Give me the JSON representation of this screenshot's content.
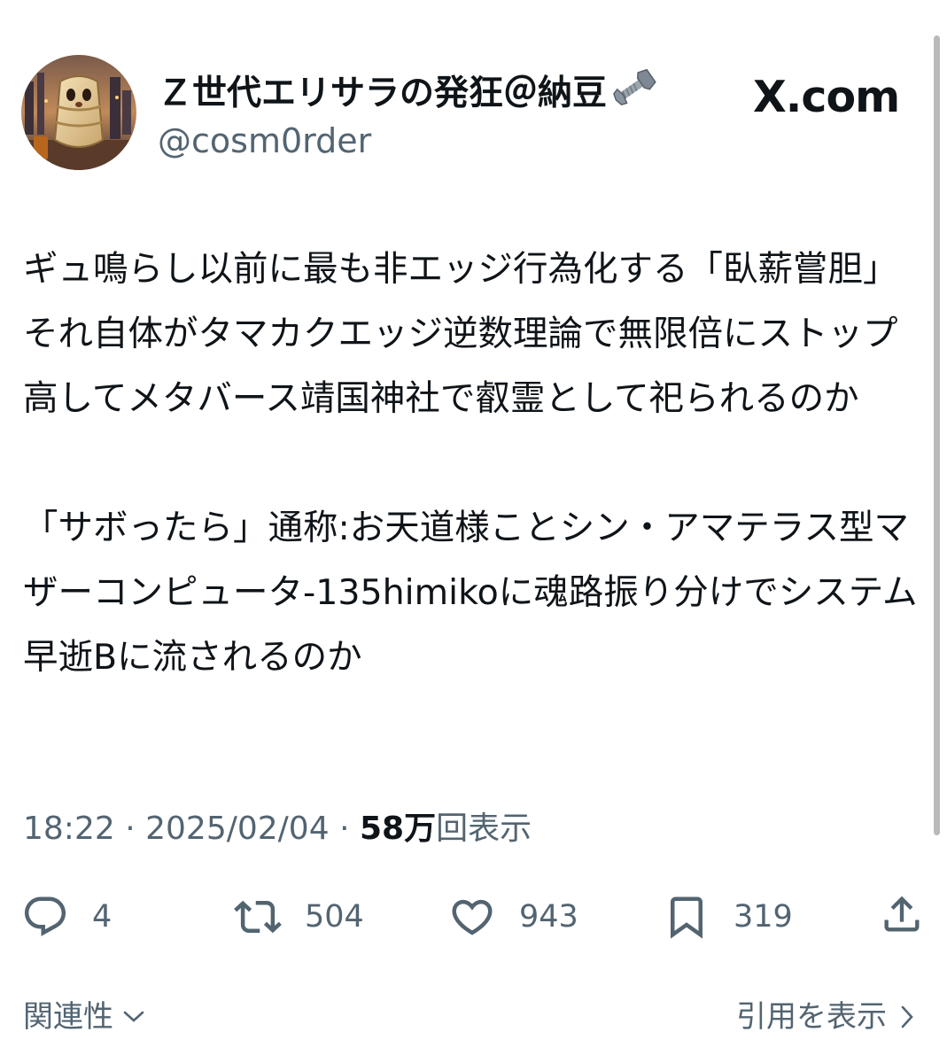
{
  "author": {
    "display_name": "Ｚ世代エリサラの発狂＠納豆",
    "handle": "@cosm0rder",
    "name_emoji_icon": "nut-and-bolt-icon"
  },
  "source": "X.com",
  "tweet": {
    "text": "ギュ鳴らし以前に最も非エッジ行為化する「臥薪嘗胆」それ自体がタマカクエッジ逆数理論で無限倍にストップ高してメタバース靖国神社で叡霊として祀られるのか\n\n「サボったら」通称:お天道様ことシン・アマテラス型マザーコンピュータ-135himikoに魂路振り分けでシステム早逝Bに流されるのか",
    "time": "18:22",
    "date": "2025/02/04",
    "separator": "·",
    "views_count": "58万",
    "views_label": "回表示"
  },
  "actions": {
    "replies": "4",
    "retweets": "504",
    "likes": "943",
    "bookmarks": "319"
  },
  "footer": {
    "related_label": "関連性",
    "quotes_label": "引用を表示"
  },
  "colors": {
    "text": "#0f1419",
    "secondary": "#536471",
    "background": "#ffffff"
  }
}
